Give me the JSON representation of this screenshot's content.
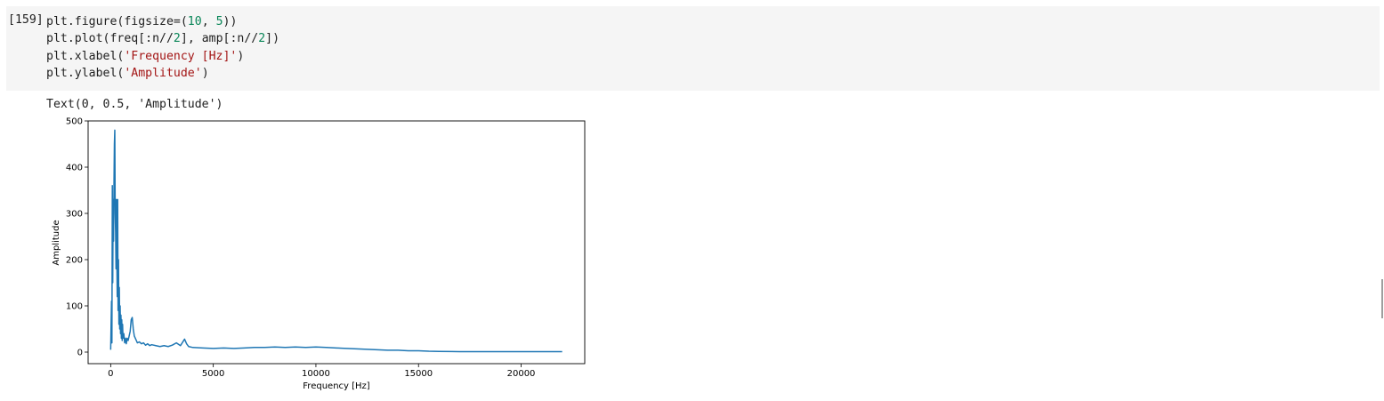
{
  "cell": {
    "execution_count": "[159]",
    "code_lines": [
      [
        {
          "t": "plt.figure(figsize=("
        },
        {
          "t": "10",
          "c": "num"
        },
        {
          "t": ", "
        },
        {
          "t": "5",
          "c": "num"
        },
        {
          "t": "))"
        }
      ],
      [
        {
          "t": "plt.plot(freq[:n//"
        },
        {
          "t": "2",
          "c": "num"
        },
        {
          "t": "], amp[:n//"
        },
        {
          "t": "2",
          "c": "num"
        },
        {
          "t": "])"
        }
      ],
      [
        {
          "t": "plt.xlabel("
        },
        {
          "t": "'Frequency [Hz]'",
          "c": "str"
        },
        {
          "t": ")"
        }
      ],
      [
        {
          "t": "plt.ylabel("
        },
        {
          "t": "'Amplitude'",
          "c": "str"
        },
        {
          "t": ")"
        }
      ]
    ],
    "output_text": "Text(0, 0.5, 'Amplitude')"
  },
  "chart_data": {
    "type": "line",
    "title": "",
    "xlabel": "Frequency [Hz]",
    "ylabel": "Amplitude",
    "xlim": [
      -1100,
      23100
    ],
    "ylim": [
      -25,
      500
    ],
    "xticks": [
      0,
      5000,
      10000,
      15000,
      20000
    ],
    "yticks": [
      0,
      100,
      200,
      300,
      400,
      500
    ],
    "grid": false,
    "line_color": "#1f77b4",
    "series": [
      {
        "x": [
          0,
          20,
          40,
          60,
          80,
          100,
          120,
          140,
          160,
          180,
          200,
          220,
          240,
          260,
          280,
          300,
          320,
          340,
          360,
          380,
          400,
          420,
          440,
          460,
          480,
          500,
          520,
          540,
          560,
          580,
          600,
          640,
          680,
          720,
          760,
          800,
          850,
          900,
          950,
          1000,
          1050,
          1100,
          1150,
          1200,
          1250,
          1300,
          1400,
          1500,
          1600,
          1700,
          1800,
          1900,
          2000,
          2200,
          2400,
          2600,
          2800,
          3000,
          3200,
          3400,
          3600,
          3700,
          3800,
          4000,
          4500,
          5000,
          5500,
          6000,
          6500,
          7000,
          7500,
          8000,
          8500,
          9000,
          9500,
          10000,
          10500,
          11000,
          11500,
          12000,
          12500,
          13000,
          13500,
          14000,
          14500,
          15000,
          15500,
          16000,
          17000,
          18000,
          19000,
          20000,
          21000,
          22000
        ],
        "y": [
          5,
          60,
          110,
          20,
          360,
          150,
          330,
          240,
          360,
          450,
          480,
          300,
          260,
          180,
          330,
          200,
          120,
          330,
          90,
          200,
          60,
          140,
          50,
          100,
          40,
          80,
          30,
          70,
          25,
          60,
          30,
          40,
          20,
          30,
          18,
          30,
          25,
          35,
          45,
          70,
          75,
          50,
          35,
          30,
          25,
          20,
          22,
          18,
          20,
          15,
          18,
          14,
          16,
          14,
          12,
          14,
          12,
          15,
          20,
          14,
          28,
          18,
          12,
          10,
          9,
          8,
          9,
          8,
          9,
          10,
          10,
          11,
          10,
          11,
          10,
          11,
          10,
          9,
          8,
          7,
          6,
          5,
          4,
          4,
          3,
          3,
          2,
          1.5,
          1,
          1,
          1,
          1,
          1,
          1
        ]
      }
    ]
  }
}
